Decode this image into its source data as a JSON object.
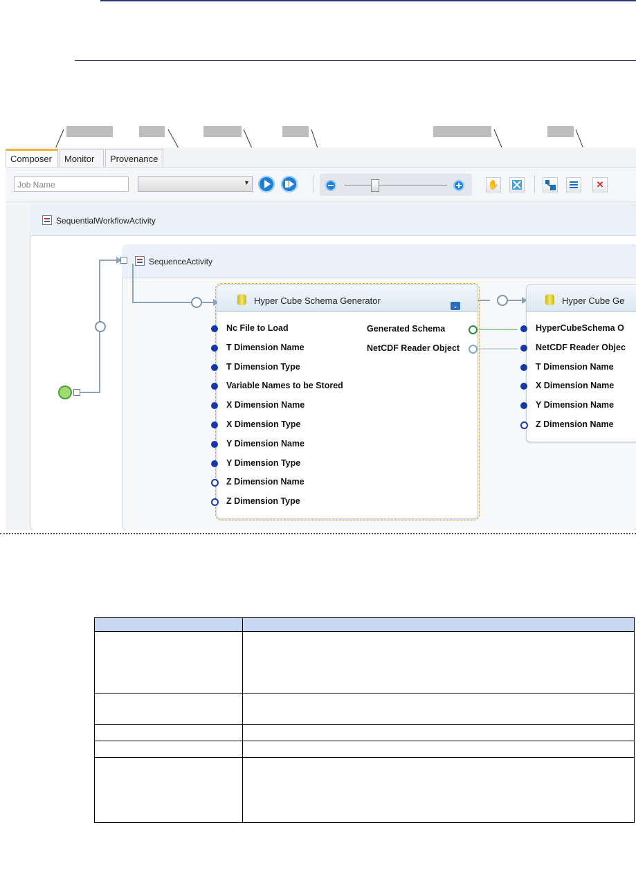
{
  "tabs": [
    "Composer",
    "Monitor",
    "Provenance"
  ],
  "job_name": {
    "placeholder": "Job Name"
  },
  "dropdown": {
    "arrow": "▾"
  },
  "toolbar_icons": [
    "play-icon",
    "run-step-icon",
    "zoom-out-icon",
    "zoom-slider",
    "zoom-in-icon",
    "pan-hand-icon",
    "fit-to-screen-icon",
    "auto-layout-icon",
    "list-icon",
    "close-icon"
  ],
  "workflow": {
    "outer_activity": "SequentialWorkflowActivity",
    "sequence_activity": "SequenceActivity",
    "activity1": {
      "title": "Hyper Cube Schema Generator",
      "inputs": [
        {
          "label": "Nc File to Load",
          "filled": true
        },
        {
          "label": "T Dimension Name",
          "filled": true
        },
        {
          "label": "T Dimension Type",
          "filled": true
        },
        {
          "label": "Variable Names to be Stored",
          "filled": true
        },
        {
          "label": "X Dimension Name",
          "filled": true
        },
        {
          "label": "X Dimension Type",
          "filled": true
        },
        {
          "label": "Y Dimension Name",
          "filled": true
        },
        {
          "label": "Y Dimension Type",
          "filled": true
        },
        {
          "label": "Z Dimension Name",
          "filled": false
        },
        {
          "label": "Z Dimension Type",
          "filled": false
        }
      ],
      "outputs": [
        "Generated Schema",
        "NetCDF Reader Object"
      ]
    },
    "activity2": {
      "title": "Hyper Cube Ge",
      "inputs": [
        {
          "label": "HyperCubeSchema O",
          "filled": true
        },
        {
          "label": "NetCDF Reader Objec",
          "filled": true
        },
        {
          "label": "T Dimension Name",
          "filled": true
        },
        {
          "label": "X Dimension Name",
          "filled": true
        },
        {
          "label": "Y Dimension Name",
          "filled": true
        },
        {
          "label": "Z Dimension Name",
          "filled": false
        }
      ]
    }
  },
  "colors": {
    "accent_tab": "#f0b43a",
    "port_fill": "#1637a8",
    "button_blue": "#1f7fd6",
    "close_red": "#d22"
  }
}
